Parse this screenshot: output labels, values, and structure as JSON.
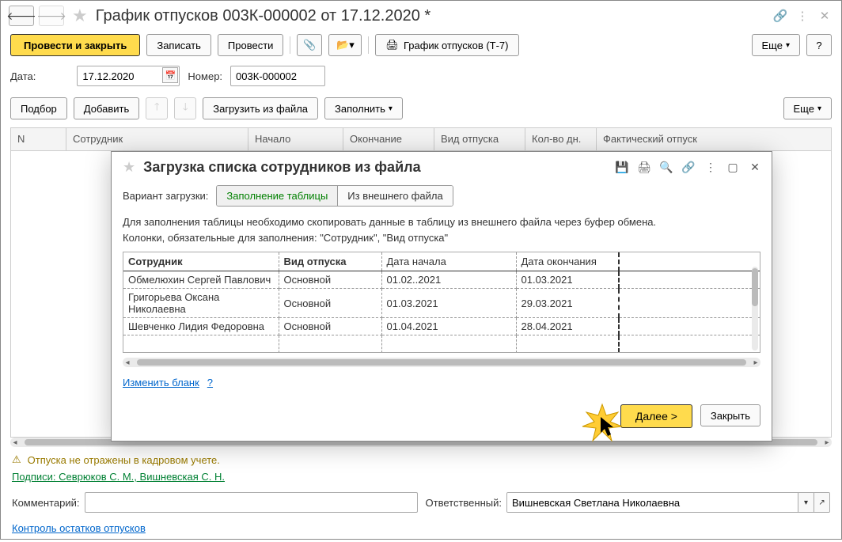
{
  "header": {
    "title": "График отпусков 003К-000002 от 17.12.2020 *"
  },
  "toolbar": {
    "post_and_close": "Провести и закрыть",
    "write": "Записать",
    "post": "Провести",
    "print": "График отпусков (Т-7)",
    "more": "Еще",
    "help": "?"
  },
  "fields": {
    "date_label": "Дата:",
    "date_value": "17.12.2020",
    "number_label": "Номер:",
    "number_value": "003К-000002"
  },
  "toolbar2": {
    "select": "Подбор",
    "add": "Добавить",
    "load_file": "Загрузить из файла",
    "fill": "Заполнить",
    "more": "Еще"
  },
  "table": {
    "cols": {
      "n": "N",
      "employee": "Сотрудник",
      "start": "Начало",
      "end": "Окончание",
      "type": "Вид отпуска",
      "days": "Кол-во дн.",
      "actual": "Фактический отпуск"
    }
  },
  "status": {
    "warn": "Отпуска не отражены в кадровом учете.",
    "sign_link": "Подписи: Севрюков С. М., Вишневская С. Н."
  },
  "bottom": {
    "comment_label": "Комментарий:",
    "comment_value": "",
    "resp_label": "Ответственный:",
    "resp_value": "Вишневская Светлана Николаевна",
    "footer_link": "Контроль остатков отпусков"
  },
  "modal": {
    "title": "Загрузка списка сотрудников из файла",
    "variant_label": "Вариант загрузки:",
    "variant_fill": "Заполнение таблицы",
    "variant_file": "Из внешнего файла",
    "info1": "Для заполнения таблицы необходимо скопировать данные в таблицу из внешнего файла через буфер обмена.",
    "info2": "Колонки, обязательные для заполнения: \"Сотрудник\", \"Вид отпуска\"",
    "cols": {
      "employee": "Сотрудник",
      "type": "Вид отпуска",
      "start": "Дата начала",
      "end": "Дата окончания"
    },
    "rows": [
      {
        "employee": "Обмелюхин Сергей Павлович",
        "type": "Основной",
        "start": "01.02..2021",
        "end": "01.03.2021"
      },
      {
        "employee": "Григорьева Оксана Николаевна",
        "type": "Основной",
        "start": "01.03.2021",
        "end": "29.03.2021"
      },
      {
        "employee": "Шевченко Лидия Федоровна",
        "type": "Основной",
        "start": "01.04.2021",
        "end": "28.04.2021"
      }
    ],
    "change_blank": "Изменить бланк",
    "help": "?",
    "next": "Далее >",
    "close": "Закрыть"
  }
}
